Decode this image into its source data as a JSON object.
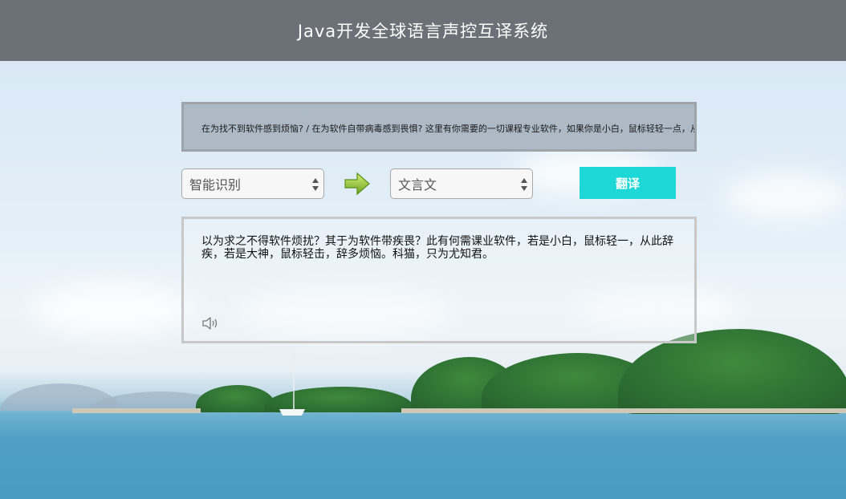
{
  "header": {
    "title": "Java开发全球语言声控互译系统"
  },
  "marquee": {
    "text": "在为找不到软件感到烦恼?  /  在为软件自带病毒感到畏惧?  这里有你需要的一切课程专业软件，如果你是小白，鼠标轻轻一点，从此告别烦恼，如果你是大神，鼠标轻击，告别繁琐。科猫，只为更懂你。"
  },
  "controls": {
    "source_language": "智能识别",
    "target_language": "文言文",
    "translate_label": "翻译",
    "arrow_icon": "right-arrow-icon",
    "accent_color": "#1ed7d7"
  },
  "output": {
    "text": "以为求之不得软件烦扰？其于为软件带疾畏？此有何需课业软件，若是小白，鼠标轻一，从此辞疾，若是大神，鼠标轻击，辞多烦恼。科猫，只为尤知君。",
    "speaker_icon": "speaker-icon"
  }
}
